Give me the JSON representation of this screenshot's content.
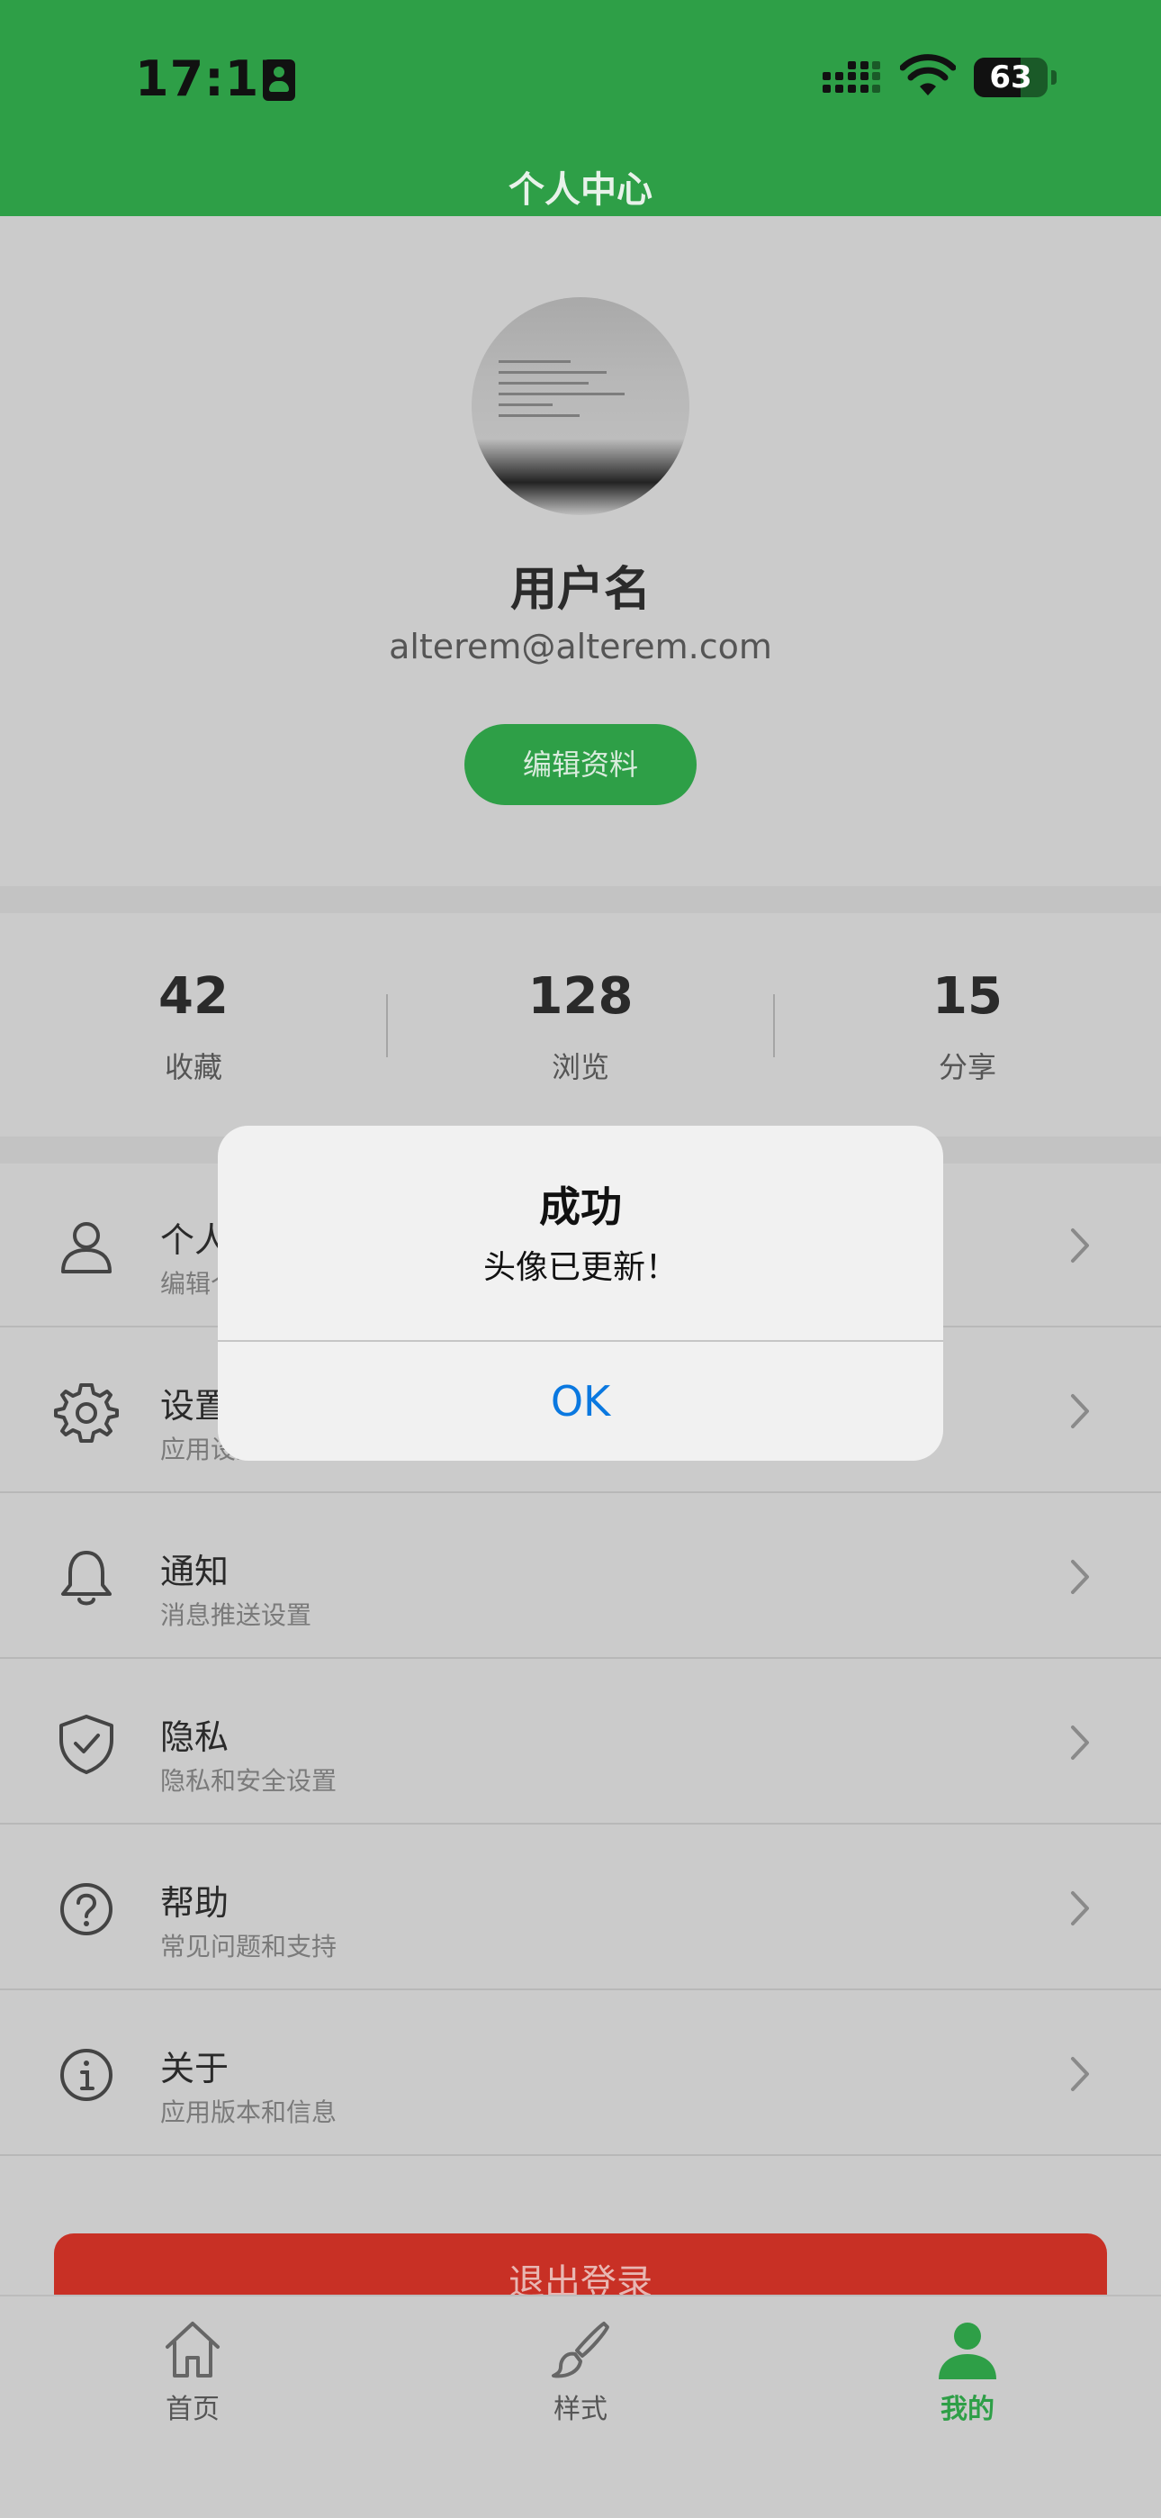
{
  "status_bar": {
    "time": "17:17",
    "battery": "63",
    "battery_level": 0.63
  },
  "header": {
    "title": "个人中心"
  },
  "profile": {
    "username": "用户名",
    "email": "alterem@alterem.com",
    "edit_label": "编辑资料"
  },
  "stats": [
    {
      "value": "42",
      "label": "收藏"
    },
    {
      "value": "128",
      "label": "浏览"
    },
    {
      "value": "15",
      "label": "分享"
    }
  ],
  "menu": [
    {
      "title": "个人信息",
      "subtitle": "编辑个人资料",
      "icon": "user-icon"
    },
    {
      "title": "设置",
      "subtitle": "应用设置",
      "icon": "gear-icon"
    },
    {
      "title": "通知",
      "subtitle": "消息推送设置",
      "icon": "bell-icon"
    },
    {
      "title": "隐私",
      "subtitle": "隐私和安全设置",
      "icon": "shield-check-icon"
    },
    {
      "title": "帮助",
      "subtitle": "常见问题和支持",
      "icon": "question-icon"
    },
    {
      "title": "关于",
      "subtitle": "应用版本和信息",
      "icon": "info-icon"
    }
  ],
  "logout_label": "退出登录",
  "tabbar": [
    {
      "label": "首页",
      "icon": "home-icon",
      "active": false
    },
    {
      "label": "样式",
      "icon": "brush-icon",
      "active": false
    },
    {
      "label": "我的",
      "icon": "person-icon",
      "active": true
    }
  ],
  "alert": {
    "title": "成功",
    "message": "头像已更新！",
    "ok_label": "OK"
  },
  "colors": {
    "brand": "#2e9f47",
    "danger": "#c83025",
    "link": "#0a78e0"
  }
}
